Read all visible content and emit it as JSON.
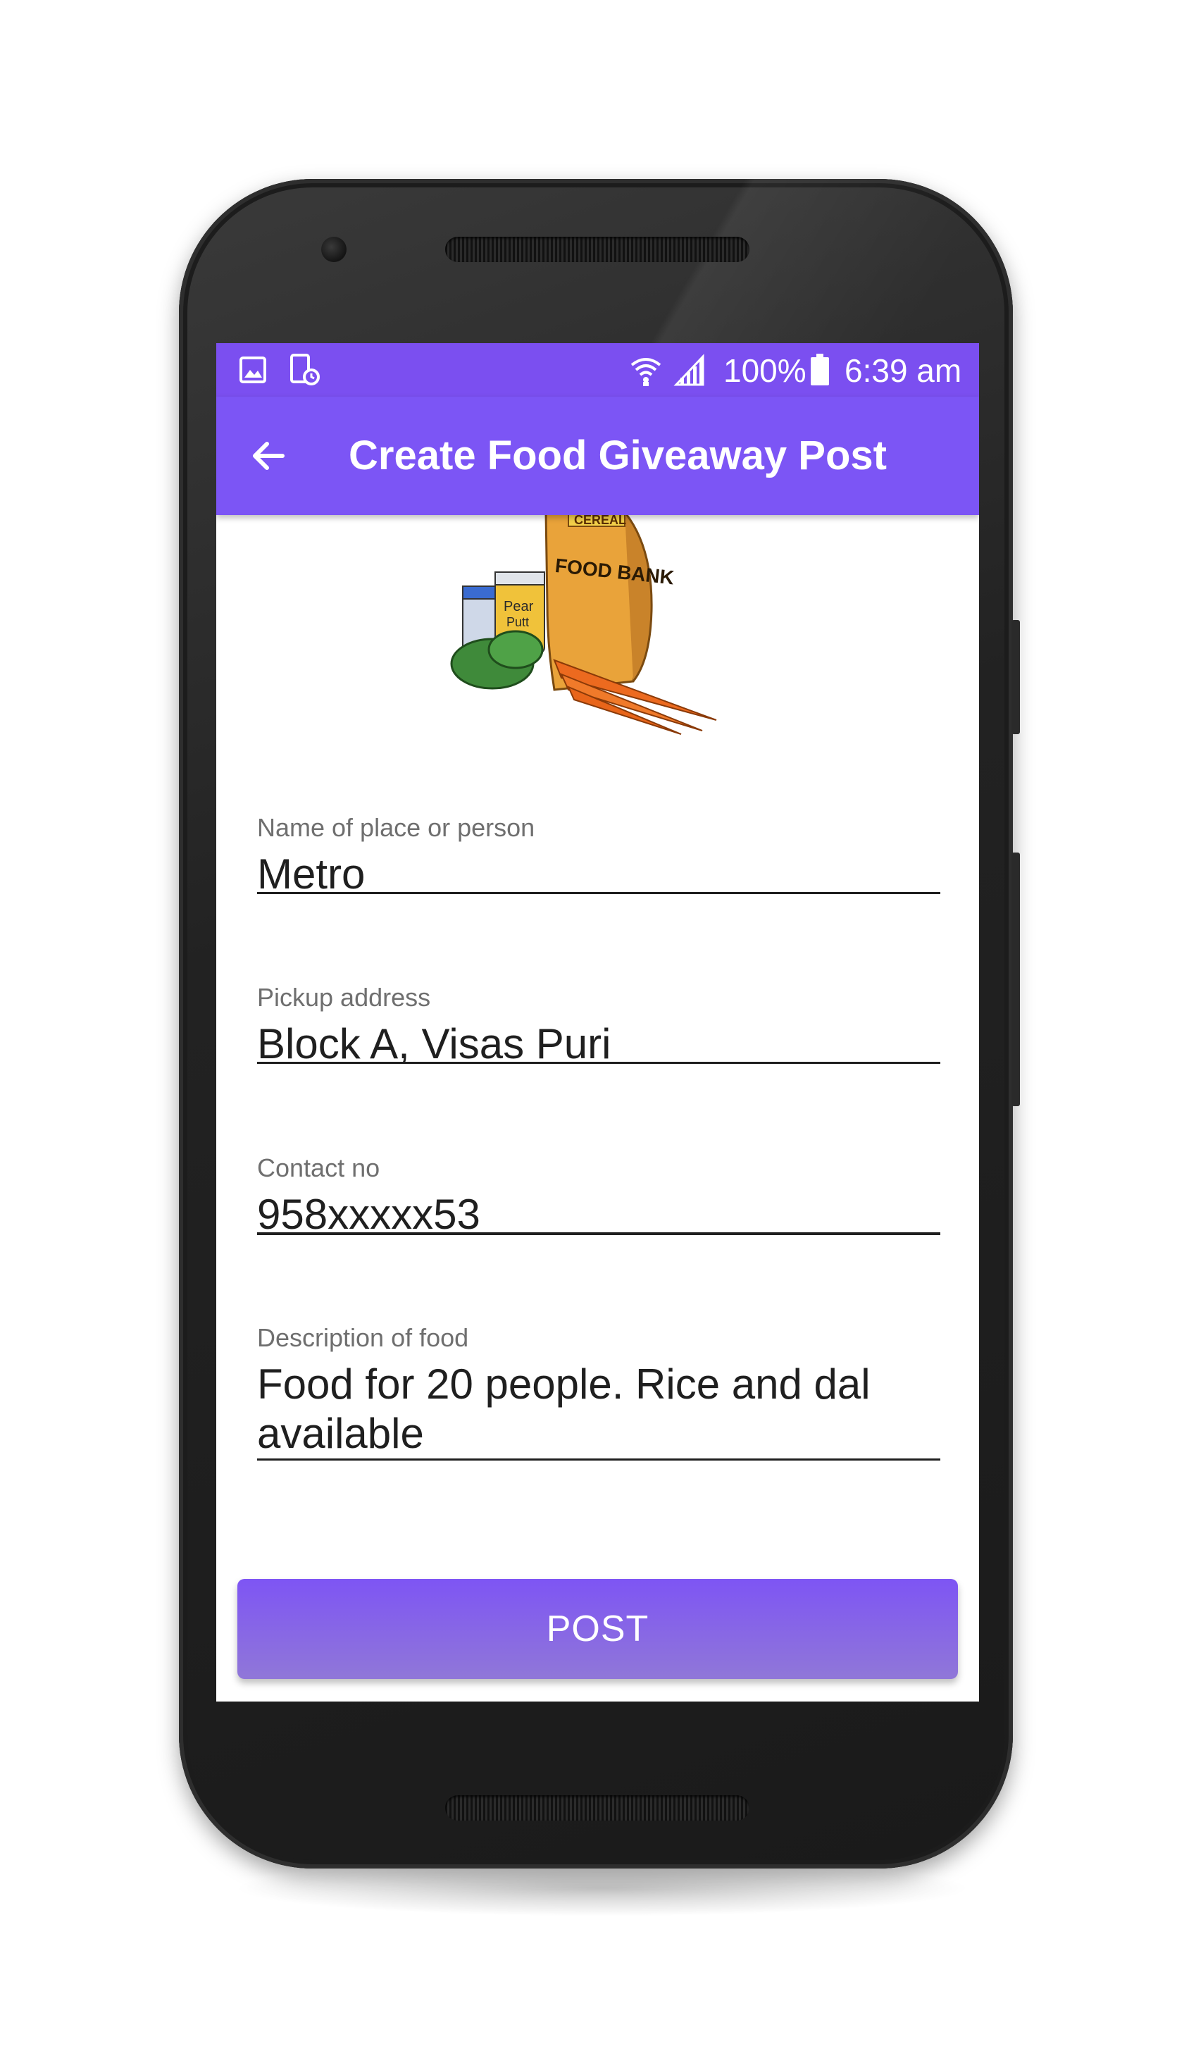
{
  "status_bar": {
    "battery": "100%",
    "time": "6:39 am",
    "icons": [
      "image-icon",
      "phone-clock-icon",
      "wifi-icon",
      "signal-icon",
      "battery-icon"
    ]
  },
  "app_bar": {
    "title": "Create Food Giveaway Post",
    "back_icon": "arrow-left-icon"
  },
  "hero_image": {
    "labels": [
      "CEREAL",
      "FOOD BANK",
      "Pear",
      "Putt"
    ]
  },
  "form": {
    "name": {
      "label": "Name of place or person",
      "value": "Metro"
    },
    "address": {
      "label": "Pickup address",
      "value": "Block A, Visas Puri"
    },
    "contact": {
      "label": "Contact no",
      "value": "958xxxxx53"
    },
    "description": {
      "label": "Description of food",
      "value_line1": "Food for 20 people. Rice and dal",
      "value_line2": "available"
    }
  },
  "post_button": {
    "label": "POST"
  },
  "colors": {
    "primary": "#7c55f5",
    "status_bar": "#7b4ff0",
    "button_bottom": "#9077d8"
  }
}
